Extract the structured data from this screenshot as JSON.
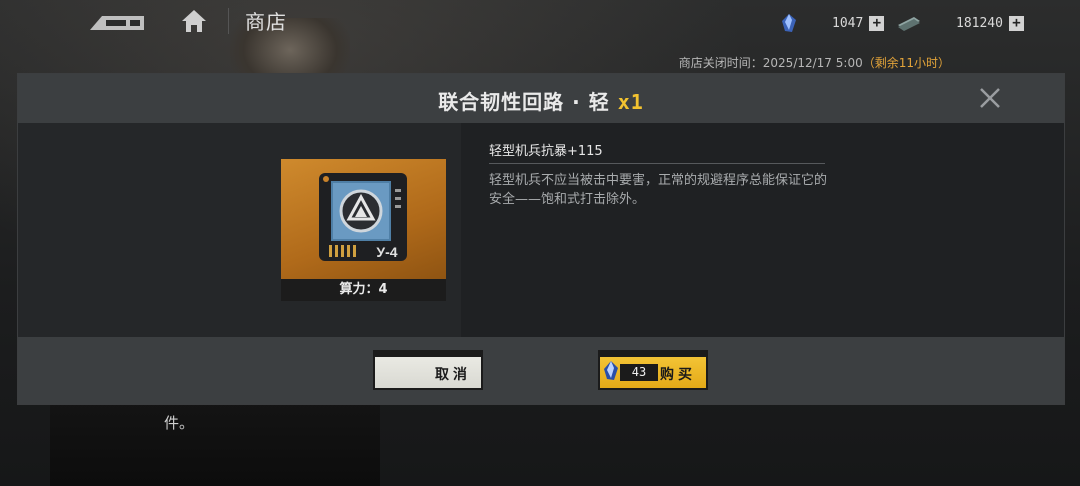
{
  "header": {
    "title": "商店",
    "currency1": {
      "icon": "crystal-gem-icon",
      "amount": "1047"
    },
    "currency2": {
      "icon": "cash-stack-icon",
      "amount": "181240"
    }
  },
  "store_close": {
    "label": "商店关闭时间：2025/12/17 5:00",
    "remaining": "（剩余11小时）"
  },
  "background": {
    "text": "件。"
  },
  "modal": {
    "title": "联合韧性回路 · 轻",
    "quantity": "x1",
    "item": {
      "power_label": "算力：4",
      "chip_code": "У-4"
    },
    "effect": "轻型机兵抗暴+115",
    "description": "轻型机兵不应当被击中要害，正常的规避程序总能保证它的安全——饱和式打击除外。",
    "cancel_label": "取消",
    "buy_label": "购买",
    "price": "43"
  },
  "colors": {
    "accent": "#f2c230",
    "buy_button": "#e4aa18",
    "remaining": "#e3a43a"
  }
}
